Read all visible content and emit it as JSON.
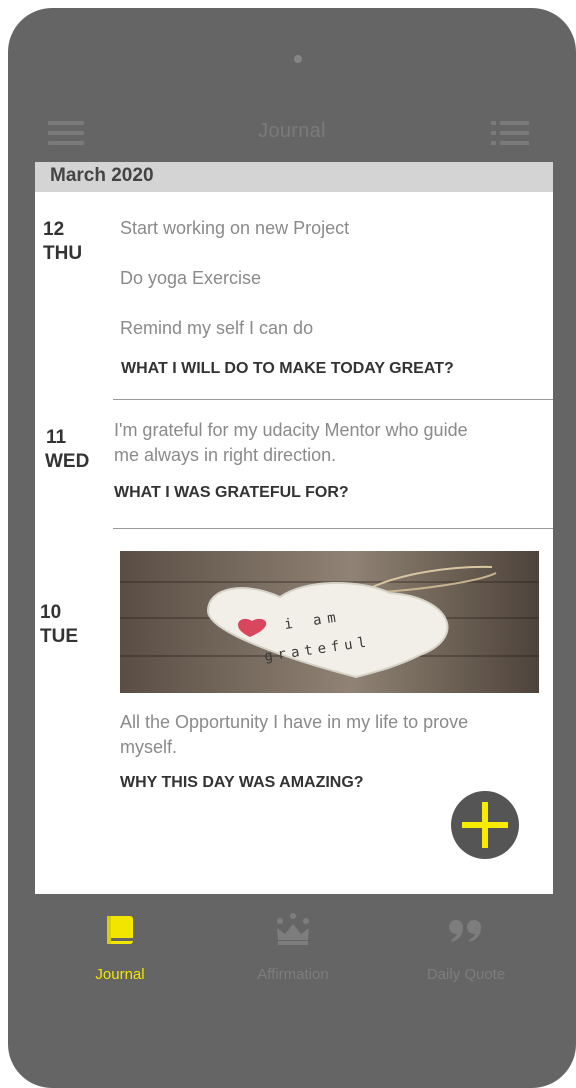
{
  "app": {
    "title": "Journal"
  },
  "month_header": "March 2020",
  "entries": [
    {
      "day": "12",
      "weekday": "THU",
      "items": [
        "Start working on new Project",
        "Do yoga Exercise",
        "Remind my self I can do"
      ],
      "question": "WHAT I WILL DO TO MAKE TODAY GREAT?"
    },
    {
      "day": "11",
      "weekday": "WED",
      "text_lines": [
        "I'm grateful for my udacity Mentor who guide",
        "me always in right direction."
      ],
      "question": "WHAT I WAS GRATEFUL FOR?"
    },
    {
      "day": "10",
      "weekday": "TUE",
      "image_text": "i am grateful",
      "text_lines": [
        "All the Opportunity I have in my life to prove",
        "myself."
      ],
      "question": "WHY THIS DAY WAS AMAZING?"
    }
  ],
  "bottom_nav": [
    {
      "label": "Journal",
      "icon": "book-icon",
      "active": true
    },
    {
      "label": "Affirmation",
      "icon": "crown-icon",
      "active": false
    },
    {
      "label": "Daily Quote",
      "icon": "quote-icon",
      "active": false
    }
  ],
  "colors": {
    "frame": "#656565",
    "accent": "#f2e600",
    "inactive": "#7d7d7d",
    "month_bar": "#d4d4d4"
  }
}
